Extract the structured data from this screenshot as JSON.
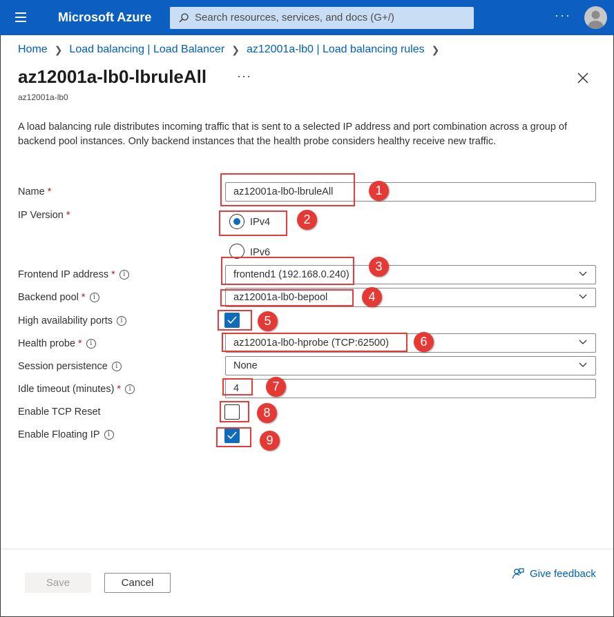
{
  "topbar": {
    "brand": "Microsoft Azure",
    "search_placeholder": "Search resources, services, and docs (G+/)",
    "more": "···"
  },
  "breadcrumb": [
    {
      "label": "Home"
    },
    {
      "label": "Load balancing | Load Balancer"
    },
    {
      "label": "az12001a-lb0 | Load balancing rules"
    }
  ],
  "header": {
    "title": "az12001a-lb0-lbruleAll",
    "more": "···",
    "subtitle": "az12001a-lb0"
  },
  "description": "A load balancing rule distributes incoming traffic that is sent to a selected IP address and port combination across a group of backend pool instances. Only backend instances that the health probe considers healthy receive new traffic.",
  "form": {
    "name_label": "Name",
    "name_value": "az12001a-lb0-lbruleAll",
    "ip_version_label": "IP Version",
    "ipv4_label": "IPv4",
    "ipv6_label": "IPv6",
    "ip_version_selected": "IPv4",
    "frontend_label": "Frontend IP address",
    "frontend_value": "frontend1 (192.168.0.240)",
    "backend_label": "Backend pool",
    "backend_value": "az12001a-lb0-bepool",
    "ha_ports_label": "High availability ports",
    "ha_ports_checked": true,
    "probe_label": "Health probe",
    "probe_value": "az12001a-lb0-hprobe (TCP:62500)",
    "session_label": "Session persistence",
    "session_value": "None",
    "idle_label": "Idle timeout (minutes)",
    "idle_value": "4",
    "tcp_reset_label": "Enable TCP Reset",
    "tcp_reset_checked": false,
    "floating_label": "Enable Floating IP",
    "floating_checked": true,
    "required_mark": "*",
    "info_glyph": "i"
  },
  "annotations": [
    "1",
    "2",
    "3",
    "4",
    "5",
    "6",
    "7",
    "8",
    "9"
  ],
  "footer": {
    "save_label": "Save",
    "cancel_label": "Cancel",
    "feedback_label": "Give feedback"
  },
  "colors": {
    "topbar": "#0c5fc0",
    "accent": "#0f6cbd",
    "annotation": "#e53935",
    "link": "#005fb8"
  }
}
